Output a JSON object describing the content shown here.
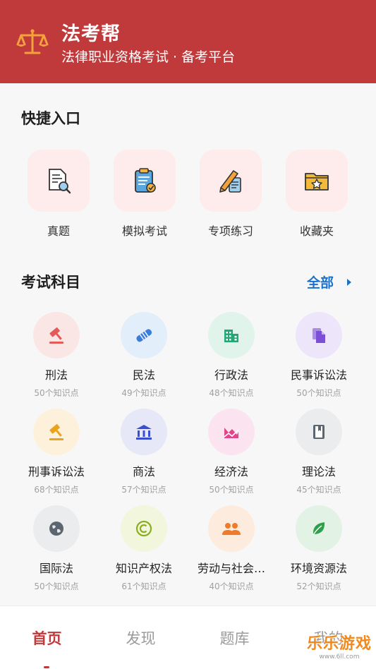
{
  "header": {
    "title": "法考帮",
    "subtitle": "法律职业资格考试 · 备考平台",
    "color": "#c0393b"
  },
  "quick": {
    "title": "快捷入口",
    "items": [
      {
        "label": "真题",
        "icon": "document-search-icon"
      },
      {
        "label": "模拟考试",
        "icon": "clipboard-check-icon"
      },
      {
        "label": "专项练习",
        "icon": "pencil-notes-icon"
      },
      {
        "label": "收藏夹",
        "icon": "star-folder-icon"
      }
    ]
  },
  "subjects": {
    "title": "考试科目",
    "all_label": "全部",
    "items": [
      {
        "name": "刑法",
        "count": "50个知识点",
        "icon": "gavel-icon",
        "color": "#e35b58"
      },
      {
        "name": "民法",
        "count": "49个知识点",
        "icon": "handshake-icon",
        "color": "#3b7ddd"
      },
      {
        "name": "行政法",
        "count": "48个知识点",
        "icon": "building-icon",
        "color": "#22a874"
      },
      {
        "name": "民事诉讼法",
        "count": "50个知识点",
        "icon": "documents-icon",
        "color": "#7b4fd6"
      },
      {
        "name": "刑事诉讼法",
        "count": "68个知识点",
        "icon": "gavel-icon",
        "color": "#e7a41c"
      },
      {
        "name": "商法",
        "count": "57个知识点",
        "icon": "bank-icon",
        "color": "#3a4fcf"
      },
      {
        "name": "经济法",
        "count": "50个知识点",
        "icon": "chart-icon",
        "color": "#e3438d"
      },
      {
        "name": "理论法",
        "count": "45个知识点",
        "icon": "book-icon",
        "color": "#5c6670"
      },
      {
        "name": "国际法",
        "count": "50个知识点",
        "icon": "globe-icon",
        "color": "#5c6670"
      },
      {
        "name": "知识产权法",
        "count": "61个知识点",
        "icon": "copyright-icon",
        "color": "#8aae1f"
      },
      {
        "name": "劳动与社会…",
        "count": "40个知识点",
        "icon": "people-icon",
        "color": "#ef7a2a"
      },
      {
        "name": "环境资源法",
        "count": "52个知识点",
        "icon": "leaf-icon",
        "color": "#2e9f4a"
      }
    ]
  },
  "nav": {
    "tabs": [
      "首页",
      "发现",
      "题库",
      "我的"
    ],
    "active": "首页"
  },
  "watermark": {
    "text": "乐乐游戏",
    "url": "www.6ll.com"
  }
}
